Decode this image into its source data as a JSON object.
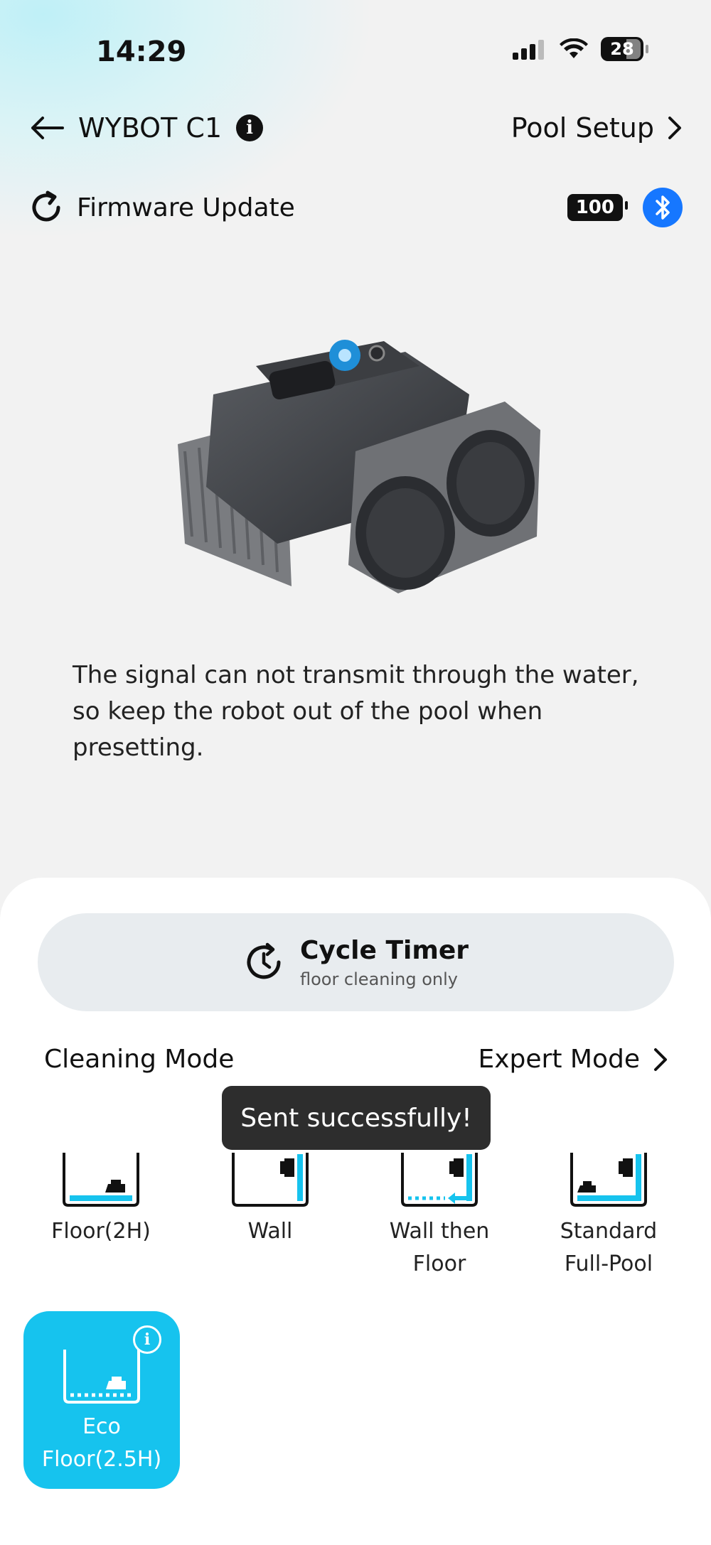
{
  "status_bar": {
    "time": "14:29",
    "battery": "28"
  },
  "header": {
    "title": "WYBOT C1",
    "info": "i",
    "pool_setup": "Pool Setup"
  },
  "firmware": {
    "label": "Firmware Update",
    "battery_level": "100"
  },
  "notice": "The signal can not transmit through the water, so keep the robot out of the pool when presetting.",
  "timer": {
    "title": "Cycle Timer",
    "subtitle": "floor cleaning only"
  },
  "cleaning": {
    "label": "Cleaning Mode",
    "expert": "Expert Mode"
  },
  "toast": "Sent successfully!",
  "modes": [
    {
      "line1": "Floor(2H)",
      "line2": ""
    },
    {
      "line1": "Wall",
      "line2": ""
    },
    {
      "line1": "Wall then",
      "line2": "Floor"
    },
    {
      "line1": "Standard",
      "line2": "Full-Pool"
    },
    {
      "line1": "Eco",
      "line2": "Floor(2.5H)",
      "selected": true
    }
  ],
  "colors": {
    "accent": "#16c3ee",
    "bluetooth": "#1677ff"
  }
}
